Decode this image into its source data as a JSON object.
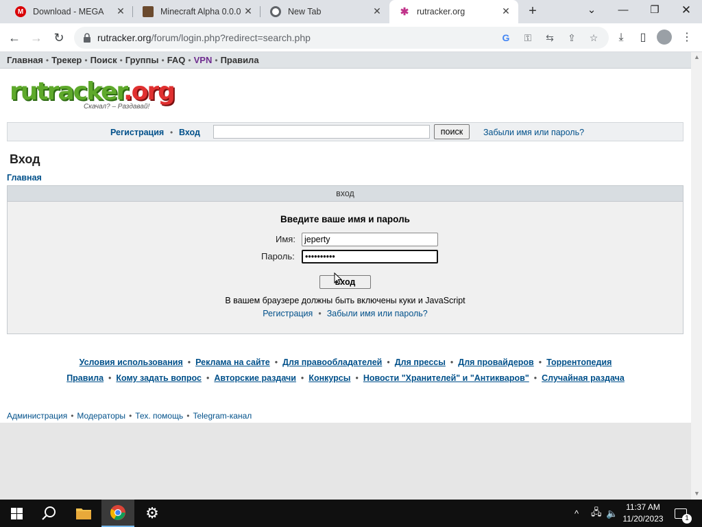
{
  "browser": {
    "tabs": [
      {
        "title": "Download - MEGA",
        "icon": "mega-icon",
        "color": "#d90007",
        "glyph": "M"
      },
      {
        "title": "Minecraft Alpha 0.0.0",
        "icon": "minecraft-icon",
        "color": "#6b4a2e",
        "glyph": ""
      },
      {
        "title": "New Tab",
        "icon": "chrome-icon",
        "color": "#5f6368",
        "glyph": ""
      },
      {
        "title": "rutracker.org",
        "icon": "rutracker-icon",
        "color": "#4a8f2b",
        "glyph": "✱"
      }
    ],
    "url_host": "rutracker.org",
    "url_path": "/forum/login.php?redirect=search.php"
  },
  "site": {
    "topnav": [
      "Главная",
      "Трекер",
      "Поиск",
      "Группы",
      "FAQ",
      "VPN",
      "Правила"
    ],
    "logo_main": "rutracker",
    "logo_tld": ".org",
    "slogan": "Скачал? – Раздавай!",
    "loginbar": {
      "register": "Регистрация",
      "login": "Вход",
      "search_button": "поиск",
      "forgot": "Забыли имя или пароль?"
    },
    "page_title": "Вход",
    "breadcrumb": "Главная"
  },
  "login_form": {
    "header": "вход",
    "prompt": "Введите ваше имя и пароль",
    "username_label": "Имя:",
    "username_value": "jeperty",
    "password_label": "Пароль:",
    "password_value": "••••••••••",
    "submit": "вход",
    "note": "В вашем браузере должны быть включены куки и JavaScript",
    "register_link": "Регистрация",
    "forgot_link": "Забыли имя или пароль?"
  },
  "footer": {
    "row1": [
      "Условия использования",
      "Реклама на сайте",
      "Для правообладателей",
      "Для прессы",
      "Для провайдеров",
      "Торрентопедия"
    ],
    "row2": [
      "Правила",
      "Кому задать вопрос",
      "Авторские раздачи",
      "Конкурсы",
      "Новости \"Хранителей\" и \"Антикваров\"",
      "Случайная раздача"
    ],
    "admin": [
      "Администрация",
      "Модераторы",
      "Тех. помощь",
      "Telegram-канал"
    ]
  },
  "taskbar": {
    "time": "11:37 AM",
    "date": "11/20/2023",
    "notifications": "1"
  }
}
